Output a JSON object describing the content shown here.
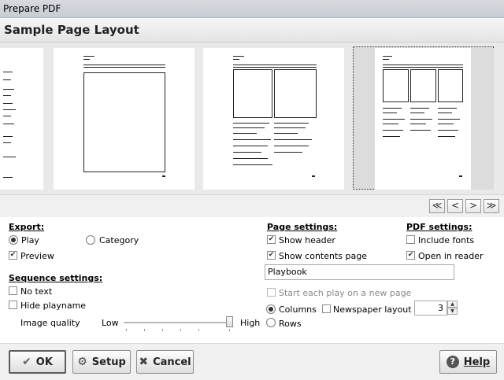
{
  "window": {
    "title": "Prepare PDF"
  },
  "header": {
    "title": "Sample Page Layout"
  },
  "navigation": {
    "first": "≪",
    "prev": "<",
    "next": ">",
    "last": "≫"
  },
  "export": {
    "heading": "Export:",
    "play_label": "Play",
    "category_label": "Category",
    "preview_label": "Preview",
    "selected": "Play",
    "preview_checked": true
  },
  "sequence": {
    "heading": "Sequence settings:",
    "no_text_label": "No text",
    "hide_playname_label": "Hide playname",
    "image_quality_label": "Image quality",
    "low_label": "Low",
    "high_label": "High",
    "image_quality": 1.0
  },
  "page_settings": {
    "heading": "Page settings:",
    "show_header_label": "Show header",
    "show_contents_label": "Show contents page",
    "title_value": "Playbook",
    "start_each_play_label": "Start each play on a new page",
    "columns_label": "Columns",
    "rows_label": "Rows",
    "newspaper_label": "Newspaper layout",
    "count": "3"
  },
  "pdf_settings": {
    "heading": "PDF settings:",
    "include_fonts_label": "Include fonts",
    "open_in_reader_label": "Open in reader"
  },
  "buttons": {
    "ok": "OK",
    "setup": "Setup",
    "cancel": "Cancel",
    "help": "Help"
  }
}
